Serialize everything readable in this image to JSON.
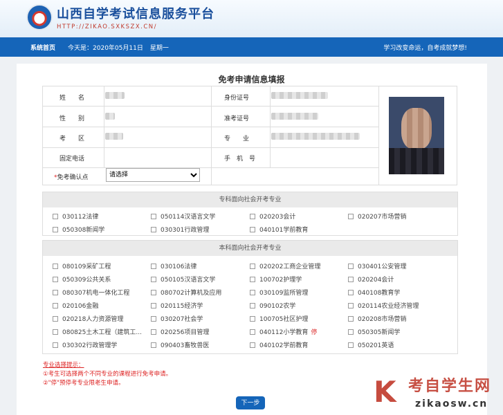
{
  "header": {
    "site_title": "山西自学考试信息服务平台",
    "site_url": "HTTP://ZIKAO.SXKSZX.CN/"
  },
  "nav": {
    "home": "系统首页",
    "date": "今天是：2020年05月11日",
    "weekday": "星期一",
    "slogan": "学习改变命运，自考成就梦想!"
  },
  "form": {
    "title": "免考申请信息填报",
    "labels": {
      "name": "姓　　名",
      "id_number": "身份证号",
      "gender": "性　　别",
      "exam_number": "准考证号",
      "district": "考　　区",
      "major": "专　　业",
      "phone": "固定电话",
      "mobile": "手　机　号",
      "confirm_point": "免考确认点"
    },
    "required_mark": "*",
    "confirm_select_value": "请选择"
  },
  "junior_section": {
    "title": "专科面向社会开考专业",
    "items": [
      "030112法律",
      "050114汉语言文学",
      "020203会计",
      "020207市场营销",
      "050308新闻学",
      "030301行政管理",
      "040101学前教育"
    ]
  },
  "bachelor_section": {
    "title": "本科面向社会开考专业",
    "items": [
      "080109采矿工程",
      "030106法律",
      "020202工商企业管理",
      "030401公安管理",
      "050309公共关系",
      "050105汉语言文学",
      "100702护理学",
      "020204会计",
      "080307机电一体化工程",
      "080702计算机及应用",
      "030109监所管理",
      "040108教育学",
      "020106金融",
      "020115经济学",
      "090102农学",
      "020114农业经济管理",
      "020218人力资源管理",
      "030207社会学",
      "100705社区护理",
      "020208市场营销",
      "080825土木工程（建筑工...",
      "020256项目管理",
      "040112小学教育",
      "050305新闻学",
      "030302行政管理学",
      "090403畜牧兽医",
      "040102学前教育",
      "050201英语"
    ],
    "stop_label": "停"
  },
  "tips": {
    "heading": "专业选择提示：",
    "line1": "①考生可选择两个不同专业的课程进行免考申请。",
    "line2": "②\"停\"预停考专业限老生申请。"
  },
  "next_button": "下一步",
  "watermark": {
    "letter": "K",
    "title": "考自学生网",
    "url": "zikaosw.cn"
  },
  "colors": {
    "nav_blue": "#1565b9",
    "brand_blue": "#1a4f9c",
    "warning_red": "#d22"
  }
}
